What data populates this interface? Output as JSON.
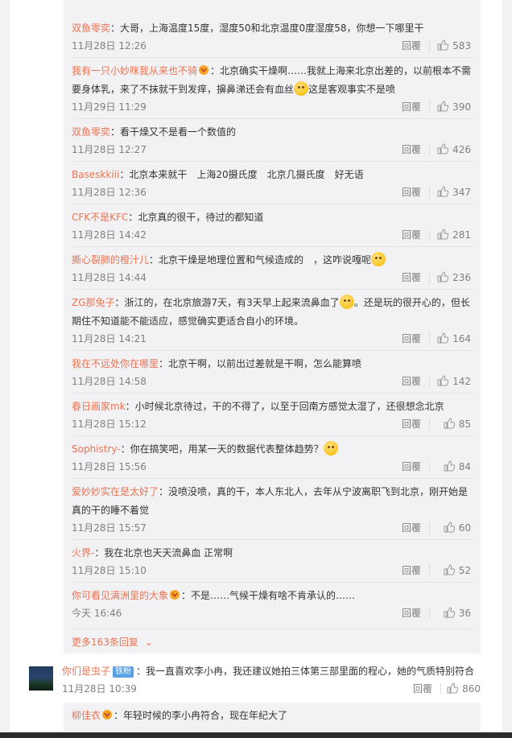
{
  "replies": [
    {
      "user": "双鱼零奕",
      "badge": false,
      "text": "：大哥，上海温度15度，湿度50和北京温度0度湿度58，你想一下哪里干",
      "emoji": false,
      "time": "11月28日 12:26",
      "reply": "回覆",
      "likes": "583"
    },
    {
      "user": "我有一只小妙咪我从来也不骑",
      "badge": true,
      "text": "：北京确实干燥啊……我就上海来北京出差的，以前根本不需要身体乳，来了不抹就干到发痒，擤鼻涕还会有血丝",
      "emoji": true,
      "text2": "这是客观事实不是喷",
      "time": "11月29日 11:29",
      "reply": "回覆",
      "likes": "390"
    },
    {
      "user": "双鱼零奕",
      "badge": false,
      "text": "：看干燥又不是看一个数值的",
      "emoji": false,
      "time": "11月28日 12:27",
      "reply": "回覆",
      "likes": "426"
    },
    {
      "user": "Basеskkiii",
      "badge": false,
      "text": "：北京本来就干　上海20摄氏度　北京几摄氏度　好无语",
      "emoji": false,
      "time": "11月28日 12:36",
      "reply": "回覆",
      "likes": "347"
    },
    {
      "user": "CFK不是KFC",
      "badge": false,
      "text": "：北京真的很干，待过的都知道",
      "emoji": false,
      "time": "11月28日 14:42",
      "reply": "回覆",
      "likes": "281"
    },
    {
      "user": "撕心裂肺的橙汁儿",
      "badge": false,
      "text": "：北京干燥是地理位置和气候造成的　，这咋说嘎呢",
      "emoji": true,
      "time": "11月28日 14:44",
      "reply": "回覆",
      "likes": "236"
    },
    {
      "user": "ZG那兔子",
      "badge": false,
      "text": "：浙江的，在北京旅游7天，有3天早上起来流鼻血了",
      "emoji": true,
      "text2": "。还是玩的很开心的，但长期住不知道能不能适应，感觉确实更适合自小的环境。",
      "time": "11月28日 14:21",
      "reply": "回覆",
      "likes": "164"
    },
    {
      "user": "我在不远处你在哪里",
      "badge": false,
      "text": "：北京干啊，以前出过差就是干啊，怎么能算喷",
      "emoji": false,
      "time": "11月28日 14:58",
      "reply": "回覆",
      "likes": "142"
    },
    {
      "user": "春日画家mk",
      "badge": false,
      "text": "：小时候北京待过，干的不得了，以至于回南方感觉太湿了，还很想念北京",
      "emoji": false,
      "time": "11月28日 15:12",
      "reply": "回覆",
      "likes": "85"
    },
    {
      "user": "Sophistry-",
      "badge": false,
      "text": "：你在搞笑吧，用某一天的数据代表整体趋势？",
      "emoji": true,
      "time": "11月28日 15:56",
      "reply": "回覆",
      "likes": "84"
    },
    {
      "user": "爱妙妙实在是太好了",
      "badge": false,
      "text": "：没喷没喷，真的干，本人东北人，去年从宁波离职飞到北京，刚开始是真的干的睡不着觉",
      "emoji": false,
      "time": "11月28日 15:57",
      "reply": "回覆",
      "likes": "60"
    },
    {
      "user": "火界-",
      "badge": false,
      "text": "：我在北京也天天流鼻血 正常啊",
      "emoji": false,
      "time": "11月28日 15:10",
      "reply": "回覆",
      "likes": "52"
    },
    {
      "user": "你可看见满洲里的大象",
      "badge": true,
      "text": "：不是……气候干燥有啥不肯承认的……",
      "emoji": false,
      "time": "今天 16:46",
      "reply": "回覆",
      "likes": "36"
    }
  ],
  "more_replies": "更多163条回复",
  "main_comment": {
    "user": "你们是虫子",
    "fan_badge": "铁粉",
    "text": "：我一直喜欢李小冉，我还建议她拍三体第三部里面的程心，她的气质特别符合",
    "time": "11月28日 10:39",
    "reply": "回覆",
    "likes": "860"
  },
  "sub_reply": {
    "user": "柳佳衣",
    "badge": true,
    "text": "：年轻时候的李小冉符合，现在年纪大了"
  },
  "colors": {
    "username": "#eb7350",
    "meta": "#808080",
    "panel": "#f2f2f5"
  }
}
